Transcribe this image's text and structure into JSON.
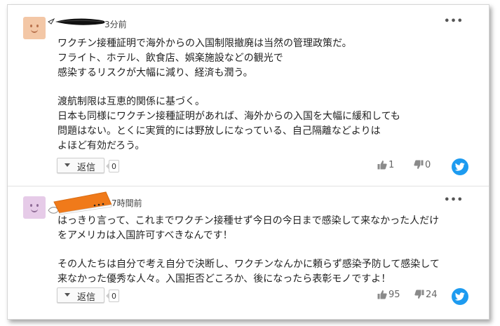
{
  "comments": [
    {
      "time": "3分前",
      "more": "•••",
      "paragraphs": [
        [
          "ワクチン接種証明で海外からの入国制限撤廃は当然の管理政策だ。",
          "フライト、ホテル、飲食店、娯楽施設などの観光で",
          "感染するリスクが大幅に減り、経済も潤う。"
        ],
        [
          "渡航制限は互恵的関係に基づく。",
          "日本も同様にワクチン接種証明があれば、海外からの入国を大幅に緩和しても",
          "問題はない。とくに実質的には野放しになっている、自己隔離などよりは",
          "よほど有効だろう。"
        ]
      ],
      "reply_label": "返信",
      "reply_count": "0",
      "likes": "1",
      "dislikes": "0"
    },
    {
      "time": "7時間前",
      "more": "•••",
      "paragraphs": [
        [
          "はっきり言って、これまでワクチン接種せず今日の今日まで感染して来なかった人だけ",
          "をアメリカは入国許可すべきなんです！"
        ],
        [
          "その人たちは自分で考え自分で決断し、ワクチンなんかに頼らず感染予防して感染して",
          "来なかった優秀な人々。入国拒否どころか、後になったら表彰モノですよ！"
        ]
      ],
      "reply_label": "返信",
      "reply_count": "0",
      "likes": "95",
      "dislikes": "24"
    }
  ],
  "icons": {
    "avatar": "smiley-avatar-icon",
    "reply": "caret-down-icon",
    "like": "thumbs-up-icon",
    "dislike": "thumbs-down-icon",
    "share": "twitter-icon",
    "more": "more-dots-icon"
  },
  "colors": {
    "twitter": "#1d9bf0",
    "avatar1": "#f3c7a6",
    "avatar2": "#e6cbe8",
    "scribble_orange": "#f07a1a"
  }
}
